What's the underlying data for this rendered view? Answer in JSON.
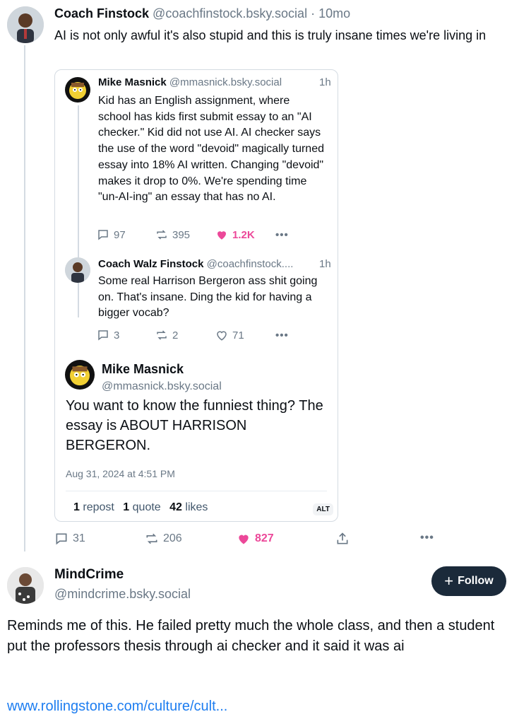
{
  "top_post": {
    "author_name": "Coach Finstock",
    "handle": "@coachfinstock.bsky.social",
    "separator": "·",
    "time": "10mo",
    "text": "AI is not only awful it's also stupid and this is truly insane times we're living in",
    "actions": {
      "replies": "31",
      "reposts": "206",
      "likes": "827"
    }
  },
  "quote": {
    "thread": [
      {
        "author_name": "Mike Masnick",
        "handle": "@mmasnick.bsky.social",
        "time": "1h",
        "text": "Kid has an English assignment, where school has kids first submit essay to an \"AI checker.\" Kid did not use AI. AI checker says the use of the word \"devoid\" magically turned essay into 18% AI written. Changing \"devoid\" makes it drop to 0%. We're spending time \"un-AI-ing\" an essay that has no AI.",
        "replies": "97",
        "reposts": "395",
        "likes": "1.2K"
      },
      {
        "author_name": "Coach Walz Finstock",
        "handle": "@coachfinstock....",
        "time": "1h",
        "text": "Some real Harrison Bergeron ass shit going on. That's insane. Ding the kid for having a bigger vocab?",
        "replies": "3",
        "reposts": "2",
        "likes": "71"
      }
    ],
    "main": {
      "author_name": "Mike Masnick",
      "handle": "@mmasnick.bsky.social",
      "text": "You want to know the funniest thing? The essay is ABOUT HARRISON BERGERON.",
      "date": "Aug 31, 2024 at 4:51 PM",
      "reposts_count": "1",
      "reposts_label": "repost",
      "quotes_count": "1",
      "quotes_label": "quote",
      "likes_count": "42",
      "likes_label": "likes"
    },
    "alt_label": "ALT"
  },
  "reply": {
    "author_name": "MindCrime",
    "handle": "@mindcrime.bsky.social",
    "follow_label": "Follow",
    "text": "Reminds me of this.  He failed pretty much the whole class, and then a student put the professors thesis through ai checker and it said it was ai",
    "link": "www.rollingstone.com/culture/cult..."
  },
  "colors": {
    "like_pink": "#ec4899",
    "link_blue": "#1d7df0",
    "follow_bg": "#1b2a3a",
    "muted": "#6a7886"
  }
}
